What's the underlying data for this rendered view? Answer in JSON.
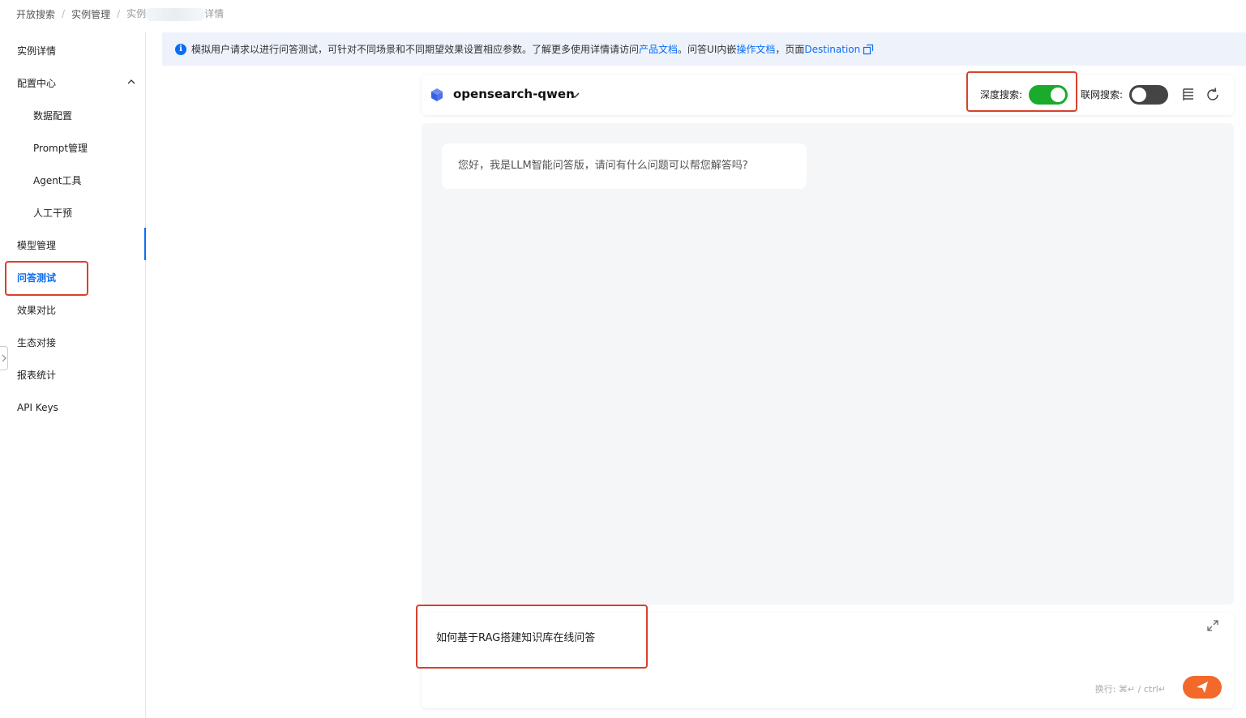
{
  "breadcrumb": {
    "items": [
      "开放搜索",
      "实例管理",
      "实例"
    ],
    "tail": "详情",
    "separator": "/"
  },
  "sidebar": {
    "items": [
      {
        "label": "实例详情"
      },
      {
        "label": "配置中心"
      },
      {
        "label": "数据配置"
      },
      {
        "label": "Prompt管理"
      },
      {
        "label": "Agent工具"
      },
      {
        "label": "人工干预"
      },
      {
        "label": "模型管理"
      },
      {
        "label": "问答测试"
      },
      {
        "label": "效果对比"
      },
      {
        "label": "生态对接"
      },
      {
        "label": "报表统计"
      },
      {
        "label": "API Keys"
      }
    ],
    "active": "问答测试"
  },
  "banner": {
    "info_icon": "i",
    "text_1": "模拟用户请求以进行问答测试，可针对不同场景和不同期望效果设置相应参数。了解更多使用详情请访问 ",
    "link_1": "产品文档",
    "text_2": "。问答UI内嵌",
    "link_2": "操作文档",
    "text_3": "，页面",
    "link_3": "Destination"
  },
  "header": {
    "model_name": "opensearch-qwen",
    "deep_search_label": "深度搜索:",
    "deep_search_on": true,
    "web_search_label": "联网搜索:",
    "web_search_on": false
  },
  "chat": {
    "greeting": "您好，我是LLM智能问答版，请问有什么问题可以帮您解答吗?"
  },
  "input": {
    "value": "如何基于RAG搭建知识库在线问答",
    "hint": "换行: ⌘↵ / ctrl↵"
  },
  "colors": {
    "accent": "#0a6cf5",
    "toggle_on": "#1aaa2c",
    "send": "#f2692a",
    "highlight_box": "#d9412c"
  }
}
